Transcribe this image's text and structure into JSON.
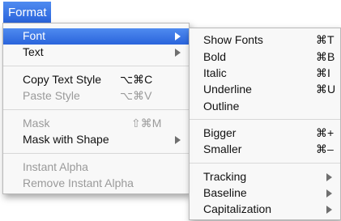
{
  "menubar": {
    "title": "Format"
  },
  "format_menu": {
    "font": "Font",
    "text": "Text",
    "copy_text_style": {
      "label": "Copy Text Style",
      "shortcut": "⌥⌘C"
    },
    "paste_style": {
      "label": "Paste Style",
      "shortcut": "⌥⌘V"
    },
    "mask": {
      "label": "Mask",
      "shortcut": "⇧⌘M"
    },
    "mask_with_shape": "Mask with Shape",
    "instant_alpha": "Instant Alpha",
    "remove_instant_alpha": "Remove Instant Alpha"
  },
  "font_submenu": {
    "show_fonts": {
      "label": "Show Fonts",
      "shortcut": "⌘T"
    },
    "bold": {
      "label": "Bold",
      "shortcut": "⌘B"
    },
    "italic": {
      "label": "Italic",
      "shortcut": "⌘I"
    },
    "underline": {
      "label": "Underline",
      "shortcut": "⌘U"
    },
    "outline": "Outline",
    "bigger": {
      "label": "Bigger",
      "shortcut": "⌘+"
    },
    "smaller": {
      "label": "Smaller",
      "shortcut": "⌘–"
    },
    "tracking": "Tracking",
    "baseline": "Baseline",
    "capitalization": "Capitalization"
  },
  "colors": {
    "highlight": "#2a64dc",
    "disabled_text": "#9a9a9a"
  }
}
